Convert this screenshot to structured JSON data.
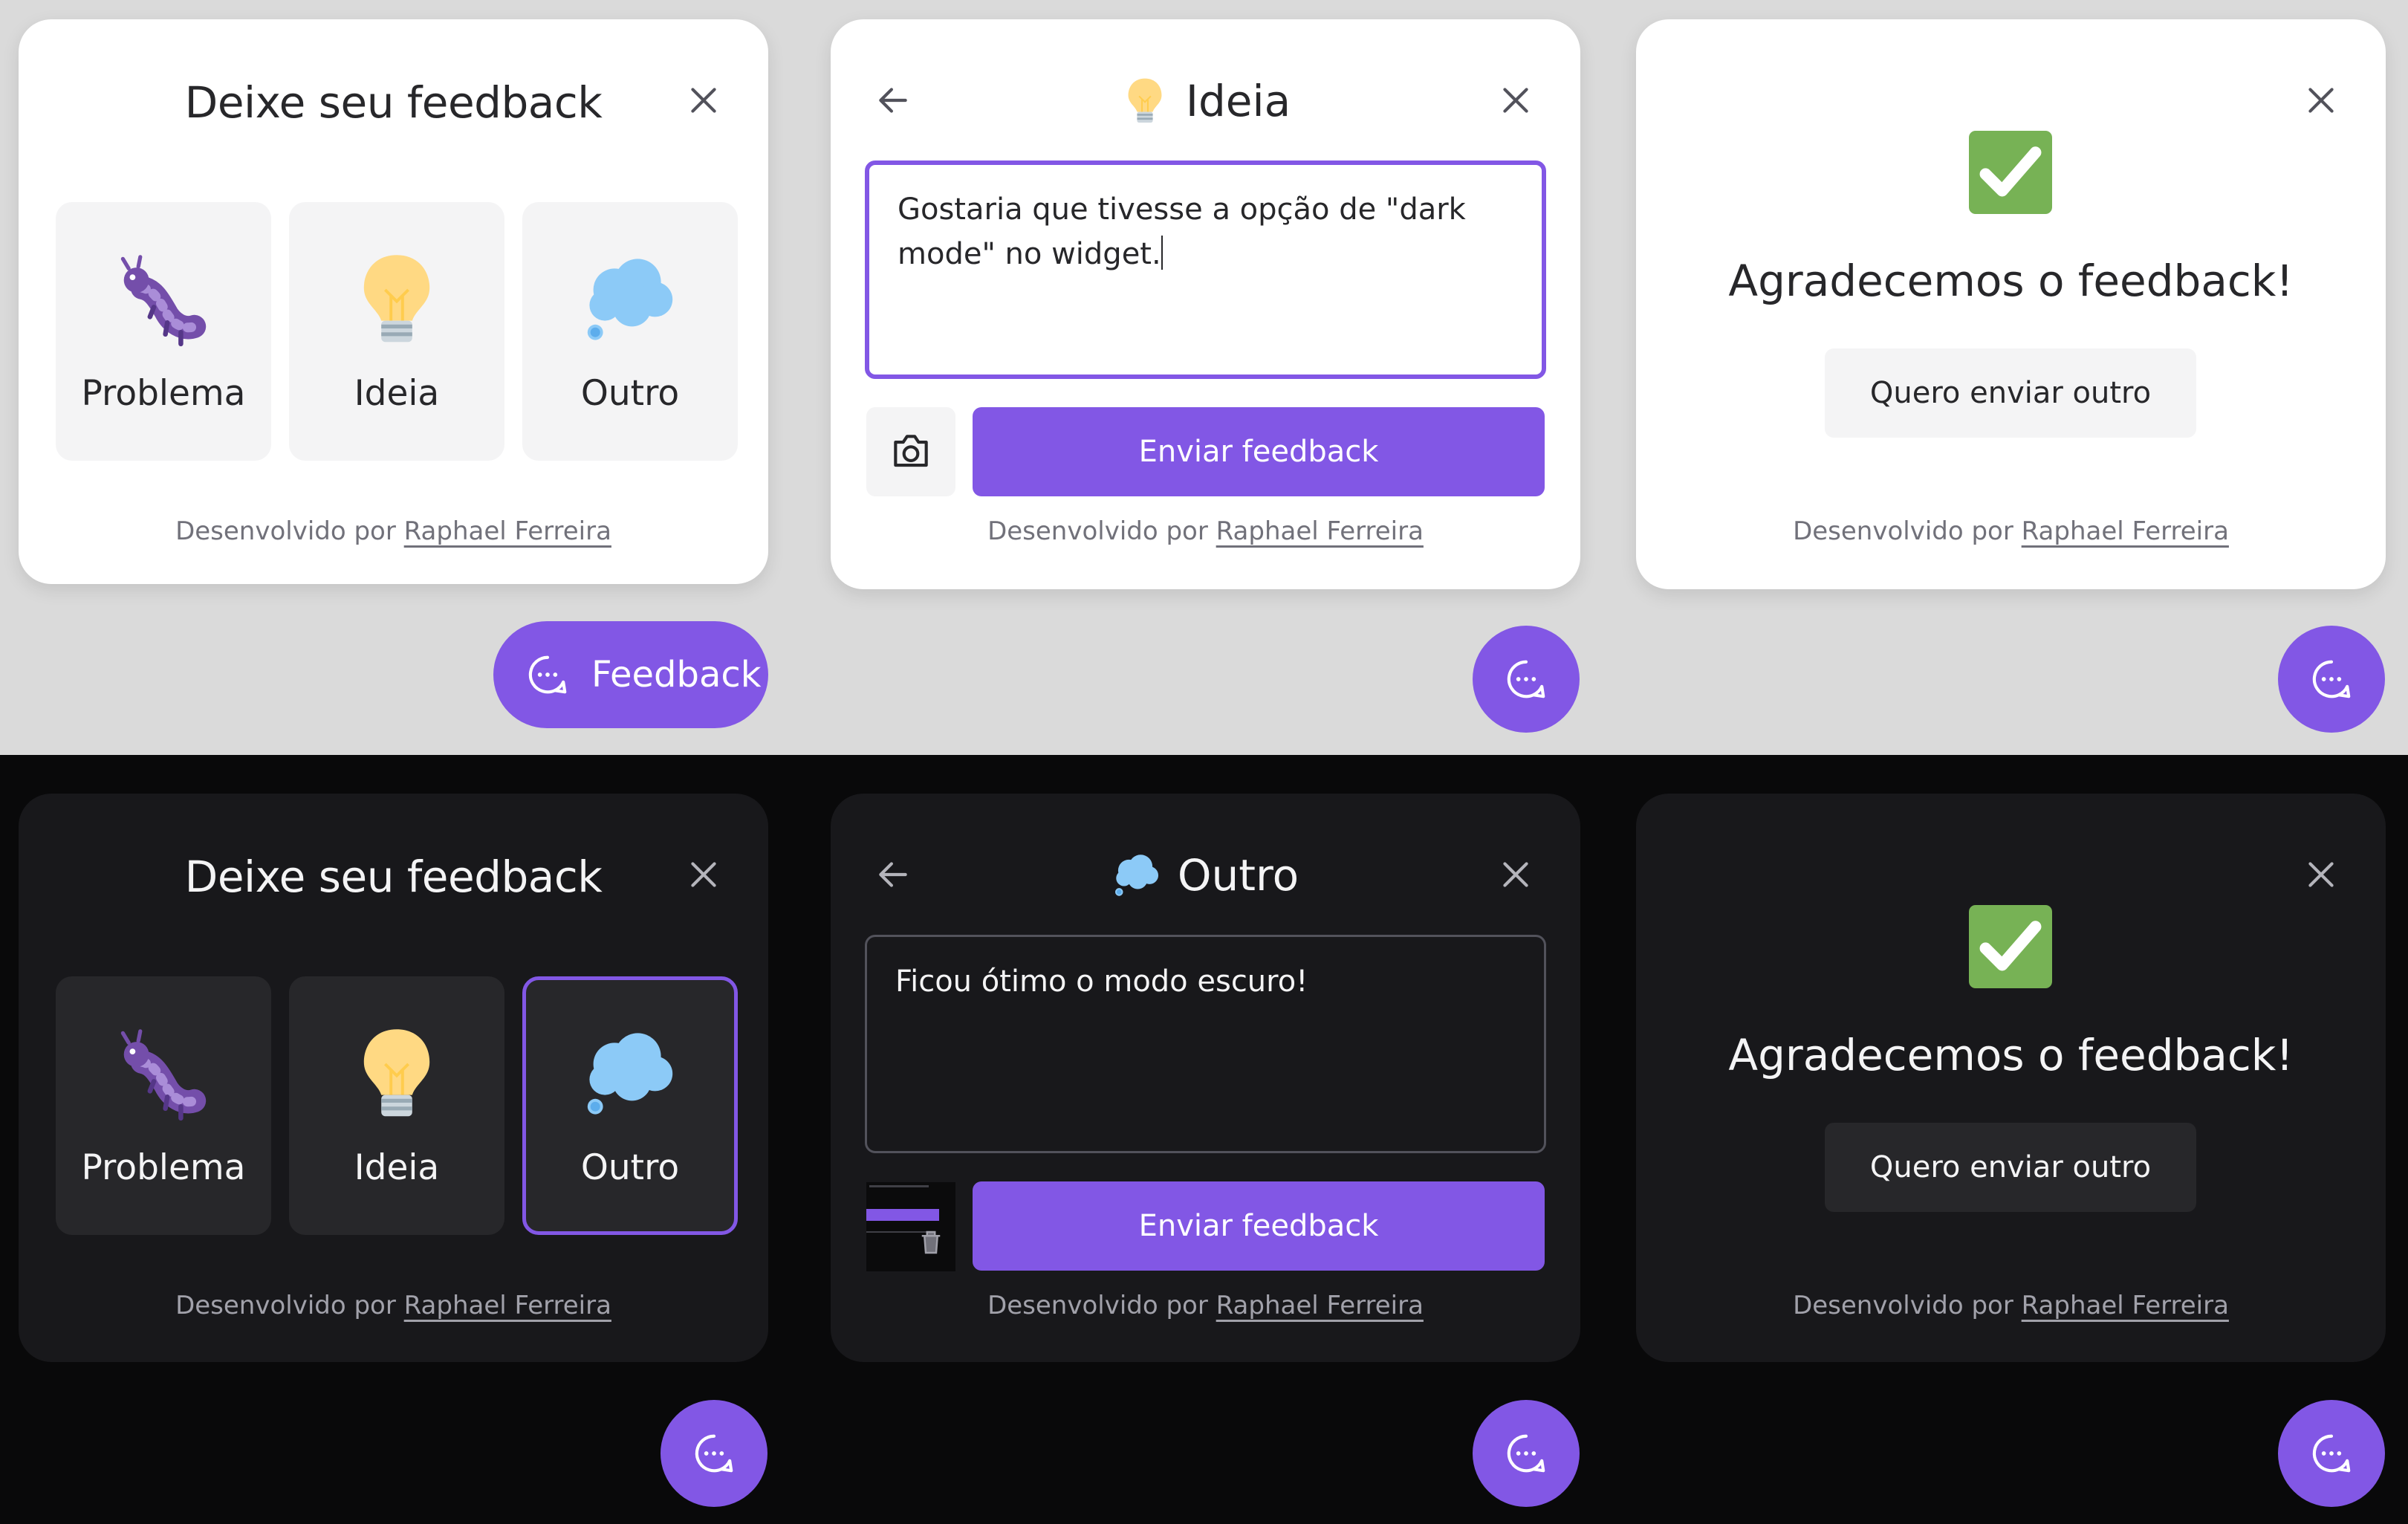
{
  "colors": {
    "brand": "#8257e5",
    "light_bg": "#dadada",
    "dark_bg": "#09090a",
    "dark_card": "#18181b",
    "check_green": "#77b255"
  },
  "light": {
    "card1": {
      "title": "Deixe seu feedback",
      "options": [
        {
          "label": "Problema",
          "icon": "caterpillar-icon"
        },
        {
          "label": "Ideia",
          "icon": "lightbulb-icon"
        },
        {
          "label": "Outro",
          "icon": "thought-balloon-icon"
        }
      ]
    },
    "card2": {
      "title": "Ideia",
      "textarea": "Gostaria que tivesse a opção de \"dark mode\" no widget.",
      "send_label": "Enviar feedback"
    },
    "card3": {
      "message": "Agradecemos o feedback!",
      "again_label": "Quero enviar outro"
    },
    "fab_label": "Feedback"
  },
  "dark": {
    "card1": {
      "title": "Deixe seu feedback",
      "options": [
        {
          "label": "Problema",
          "icon": "caterpillar-icon"
        },
        {
          "label": "Ideia",
          "icon": "lightbulb-icon"
        },
        {
          "label": "Outro",
          "icon": "thought-balloon-icon",
          "selected": true
        }
      ]
    },
    "card2": {
      "title": "Outro",
      "textarea": "Ficou ótimo o modo escuro!",
      "send_label": "Enviar feedback"
    },
    "card3": {
      "message": "Agradecemos o feedback!",
      "again_label": "Quero enviar outro"
    }
  },
  "footer": {
    "prefix": "Desenvolvido por",
    "author": "Raphael Ferreira"
  }
}
